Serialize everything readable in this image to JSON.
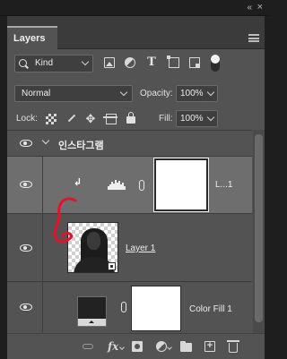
{
  "topbar": {
    "collapse_glyph": "«",
    "close_glyph": "×"
  },
  "panel": {
    "tab_label": "Layers"
  },
  "filter": {
    "kind_label": "Kind",
    "icons": [
      "image-filter-icon",
      "adjustment-filter-icon",
      "type-filter-icon",
      "shape-filter-icon",
      "smart-object-filter-icon"
    ]
  },
  "blend": {
    "mode": "Normal",
    "opacity_label": "Opacity:",
    "opacity_value": "100%"
  },
  "lock": {
    "label": "Lock:",
    "fill_label": "Fill:",
    "fill_value": "100%"
  },
  "layers": {
    "group": {
      "name": "인스타그램"
    },
    "levels": {
      "name": "L...1",
      "clip_glyph": "↲"
    },
    "layer1": {
      "name": "Layer 1"
    },
    "colorfill": {
      "name": "Color Fill 1"
    }
  },
  "bottom": {
    "fx_label": "fx"
  },
  "colors": {
    "panel": "#535353",
    "selected_row": "#6e6e6e",
    "annotation": "#e8102a"
  }
}
